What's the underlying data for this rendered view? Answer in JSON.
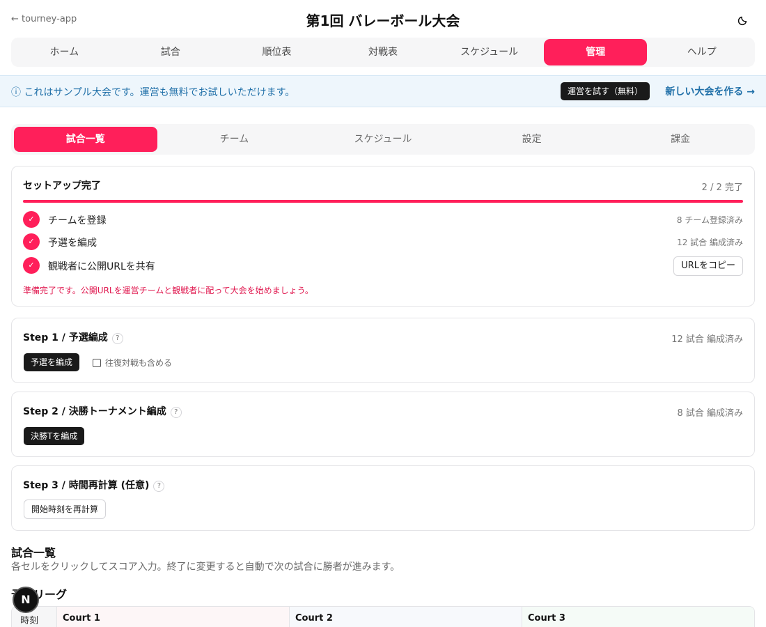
{
  "header": {
    "back_label": "← tourney-app",
    "title": "第1回 バレーボール大会"
  },
  "main_nav": [
    {
      "label": "ホーム"
    },
    {
      "label": "試合"
    },
    {
      "label": "順位表"
    },
    {
      "label": "対戦表"
    },
    {
      "label": "スケジュール"
    },
    {
      "label": "管理"
    },
    {
      "label": "ヘルプ"
    }
  ],
  "banner": {
    "text": "ⓘ これはサンプル大会です。運営も無料でお試しいただけます。",
    "try_button": "運営を試す（無料）",
    "new_link": "新しい大会を作る →"
  },
  "sub_nav": [
    {
      "label": "試合一覧"
    },
    {
      "label": "チーム"
    },
    {
      "label": "スケジュール"
    },
    {
      "label": "設定"
    },
    {
      "label": "課金"
    }
  ],
  "setup": {
    "title": "セットアップ完了",
    "progress_text": "2 / 2 完了",
    "progress_fraction": 1.0,
    "items": [
      {
        "label": "チームを登録",
        "status": "8 チーム登録済み"
      },
      {
        "label": "予選を編成",
        "status": "12 試合 編成済み"
      },
      {
        "label": "観戦者に公開URLを共有",
        "button": "URLをコピー"
      }
    ],
    "note": "準備完了です。公開URLを運営チームと観戦者に配って大会を始めましょう。"
  },
  "steps": [
    {
      "title": "Step 1 / 予選編成",
      "status": "12 試合 編成済み",
      "button": "予選を編成",
      "checkbox_label": "往復対戦も含める"
    },
    {
      "title": "Step 2 / 決勝トーナメント編成",
      "status": "8 試合 編成済み",
      "button": "決勝Tを編成"
    },
    {
      "title": "Step 3 / 時間再計算 (任意)",
      "button": "開始時刻を再計算"
    }
  ],
  "help_mark": "?",
  "matches": {
    "title": "試合一覧",
    "description": "各セルをクリックしてスコア入力。終了に変更すると自動で次の試合に勝者が進みます。",
    "league_title": "予選リーグ",
    "columns": [
      "時刻",
      "Court 1",
      "Court 2",
      "Court 3"
    ]
  },
  "fab_label": "N",
  "check_mark": "✓",
  "colors": {
    "accent": "#ff1f5a",
    "banner_text": "#1f6fa8",
    "dark_button": "#1a1a1a"
  }
}
